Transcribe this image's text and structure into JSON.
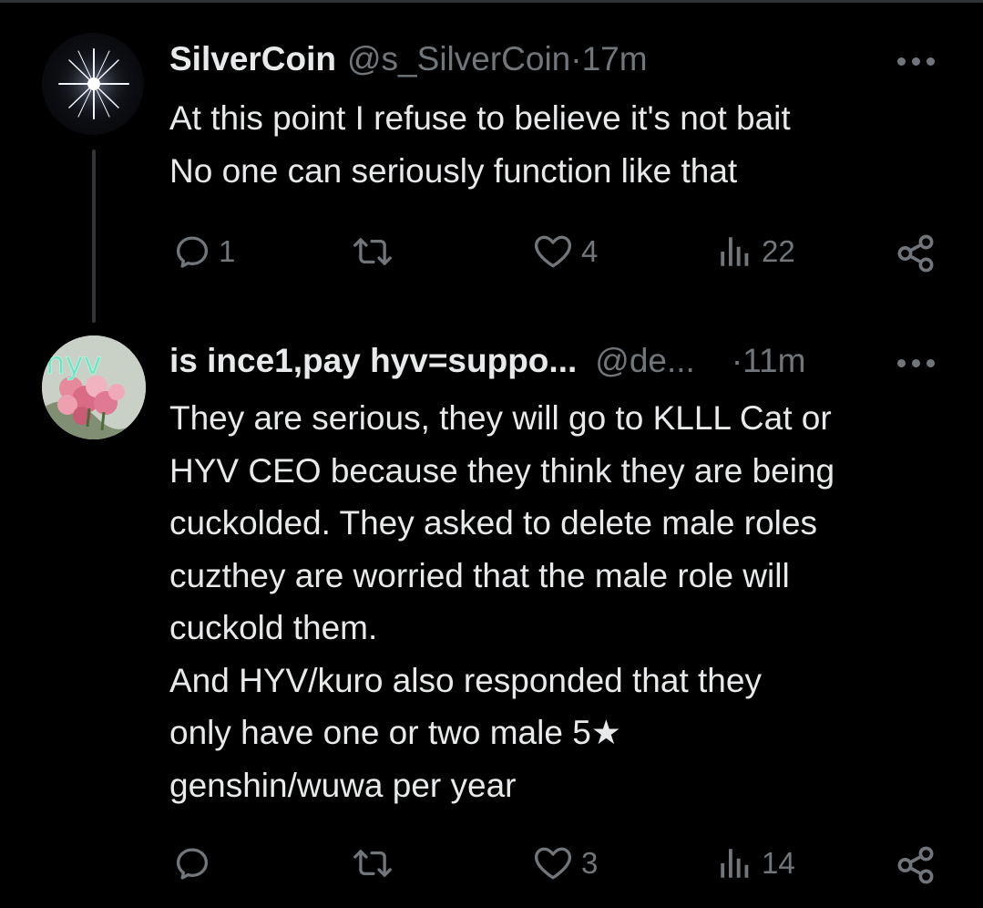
{
  "tweets": [
    {
      "display_name": "SilverCoin",
      "handle": "@s_SilverCoin",
      "separator": " · ",
      "time": "17m",
      "lines": [
        "At this point I refuse to believe it's not bait",
        "No one can seriously function like that"
      ],
      "replies": "1",
      "retweets": "",
      "likes": "4",
      "views": "22"
    },
    {
      "display_name": "is ince1,pay hyv=suppo...",
      "handle": "@de...",
      "separator": "· ",
      "time": "11m",
      "avatar_text": "hyv",
      "lines": [
        "They are serious, they will go to KLLL Cat or",
        "HYV CEO because they think they are being",
        "cuckolded. They asked to delete male roles",
        "cuzthey are worried that the male role will",
        "cuckold them.",
        "And HYV/kuro also responded that they",
        "only have one or two male 5★",
        "genshin/wuwa per year"
      ],
      "replies": "",
      "retweets": "",
      "likes": "3",
      "views": "14"
    }
  ],
  "colors": {
    "background": "#000000",
    "text": "#e7e9ea",
    "secondary": "#71767b",
    "thread_line": "#333639"
  },
  "icons": [
    "more-icon",
    "reply-icon",
    "retweet-icon",
    "like-icon",
    "views-icon",
    "share-icon"
  ]
}
